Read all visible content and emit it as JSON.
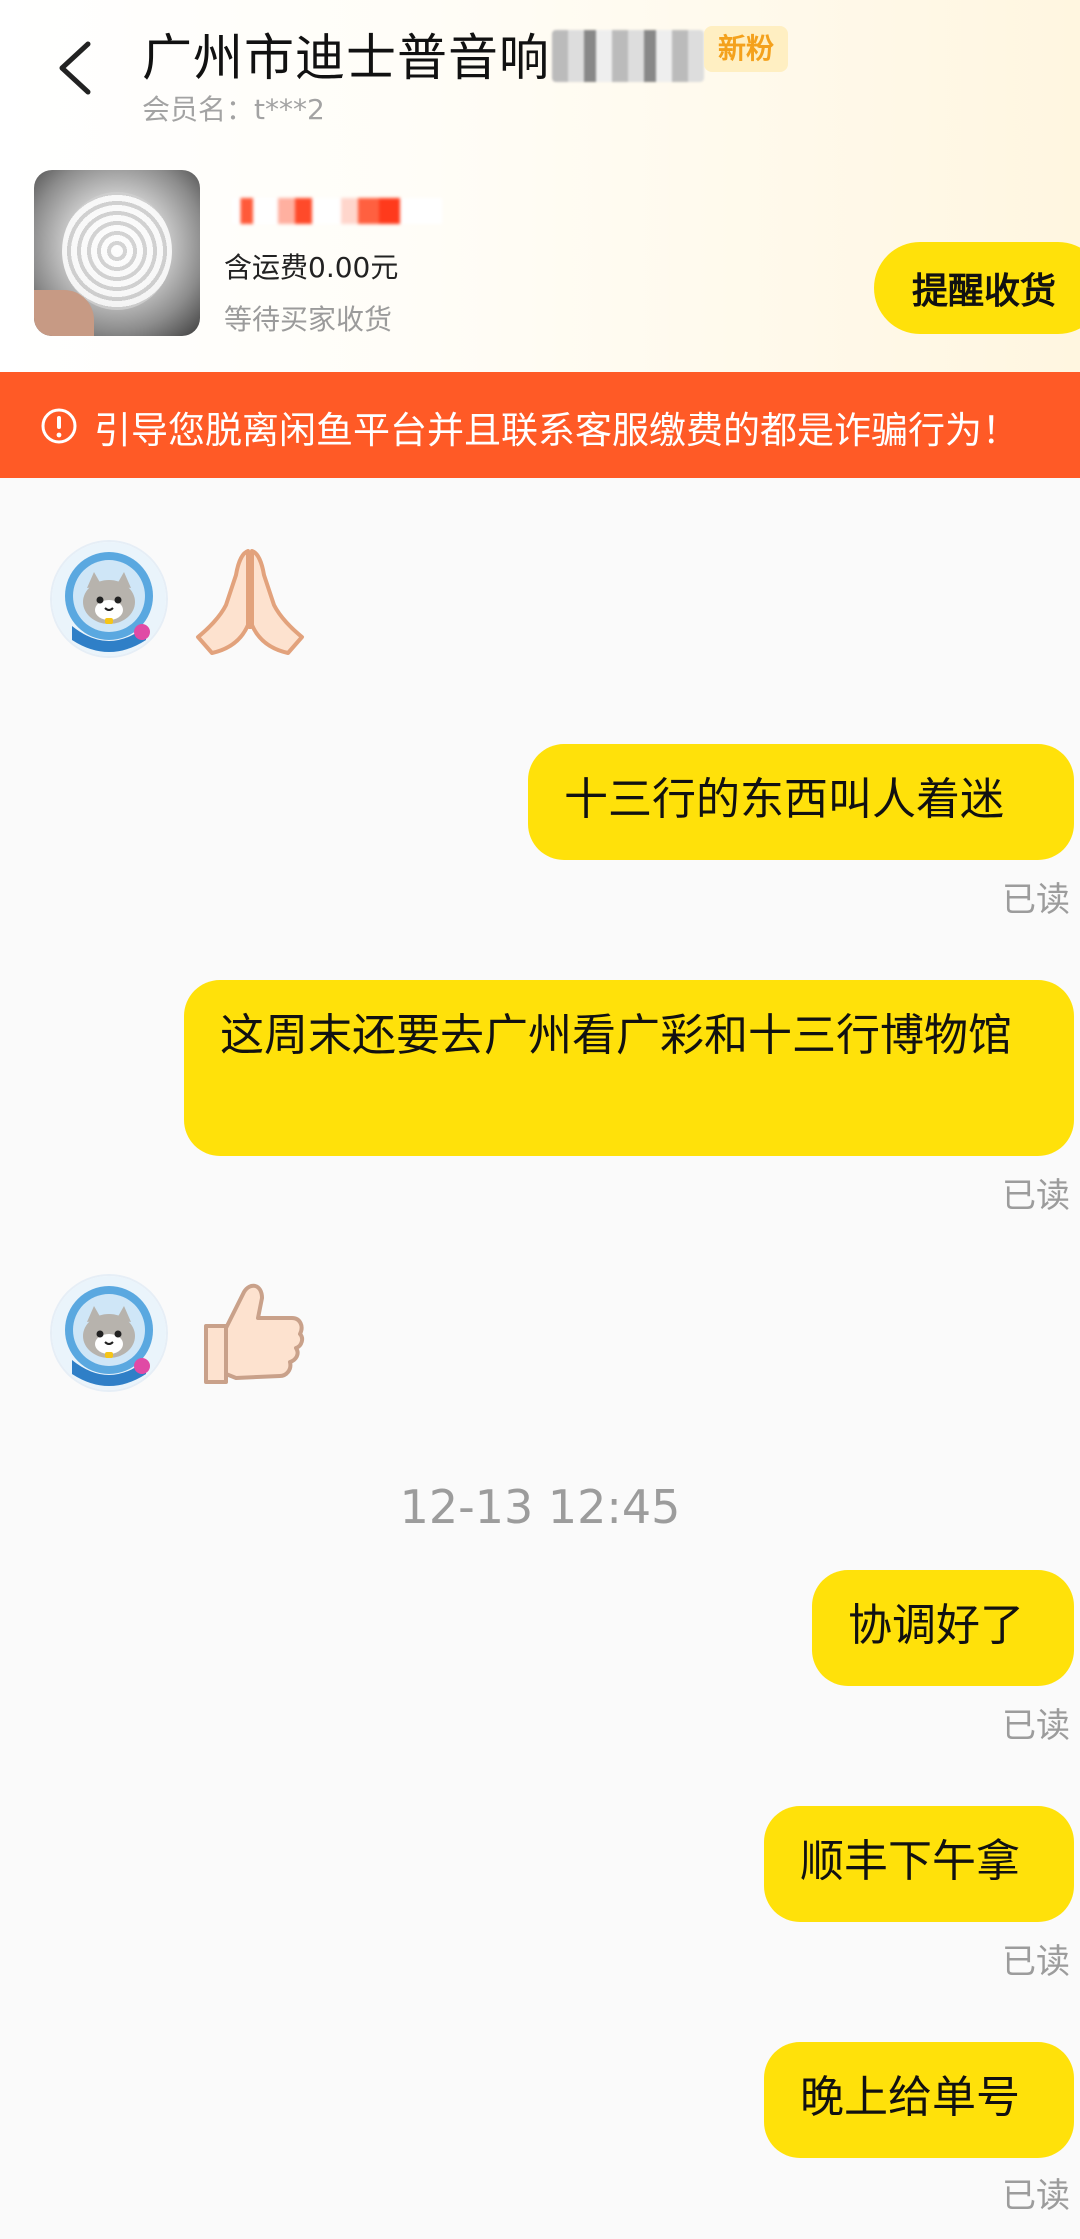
{
  "header": {
    "title": "广州市迪士普音响",
    "badge": "新粉",
    "member_label": "会员名：t***2",
    "order": {
      "shipping": "含运费0.00元",
      "status": "等待买家收货",
      "remind_button": "提醒收货"
    }
  },
  "warning": {
    "text": "引导您脱离闲鱼平台并且联系客服缴费的都是诈骗行为！"
  },
  "chat": {
    "timestamp": "12-13 12:45",
    "read_label": "已读",
    "messages": [
      {
        "side": "left",
        "type": "emoji",
        "icon": "folded-hands-icon"
      },
      {
        "side": "right",
        "text": "十三行的东西叫人着迷"
      },
      {
        "side": "right",
        "text": "这周末还要去广州看广彩和十三行博物馆"
      },
      {
        "side": "left",
        "type": "emoji",
        "icon": "thumbs-up-icon"
      },
      {
        "side": "right",
        "text": "协调好了"
      },
      {
        "side": "right",
        "text": "顺丰下午拿"
      },
      {
        "side": "right",
        "text": "晚上给单号"
      }
    ]
  },
  "colors": {
    "accent_yellow": "#ffe10a",
    "warning_orange": "#ff5a26",
    "badge_orange": "#f4a11c"
  }
}
